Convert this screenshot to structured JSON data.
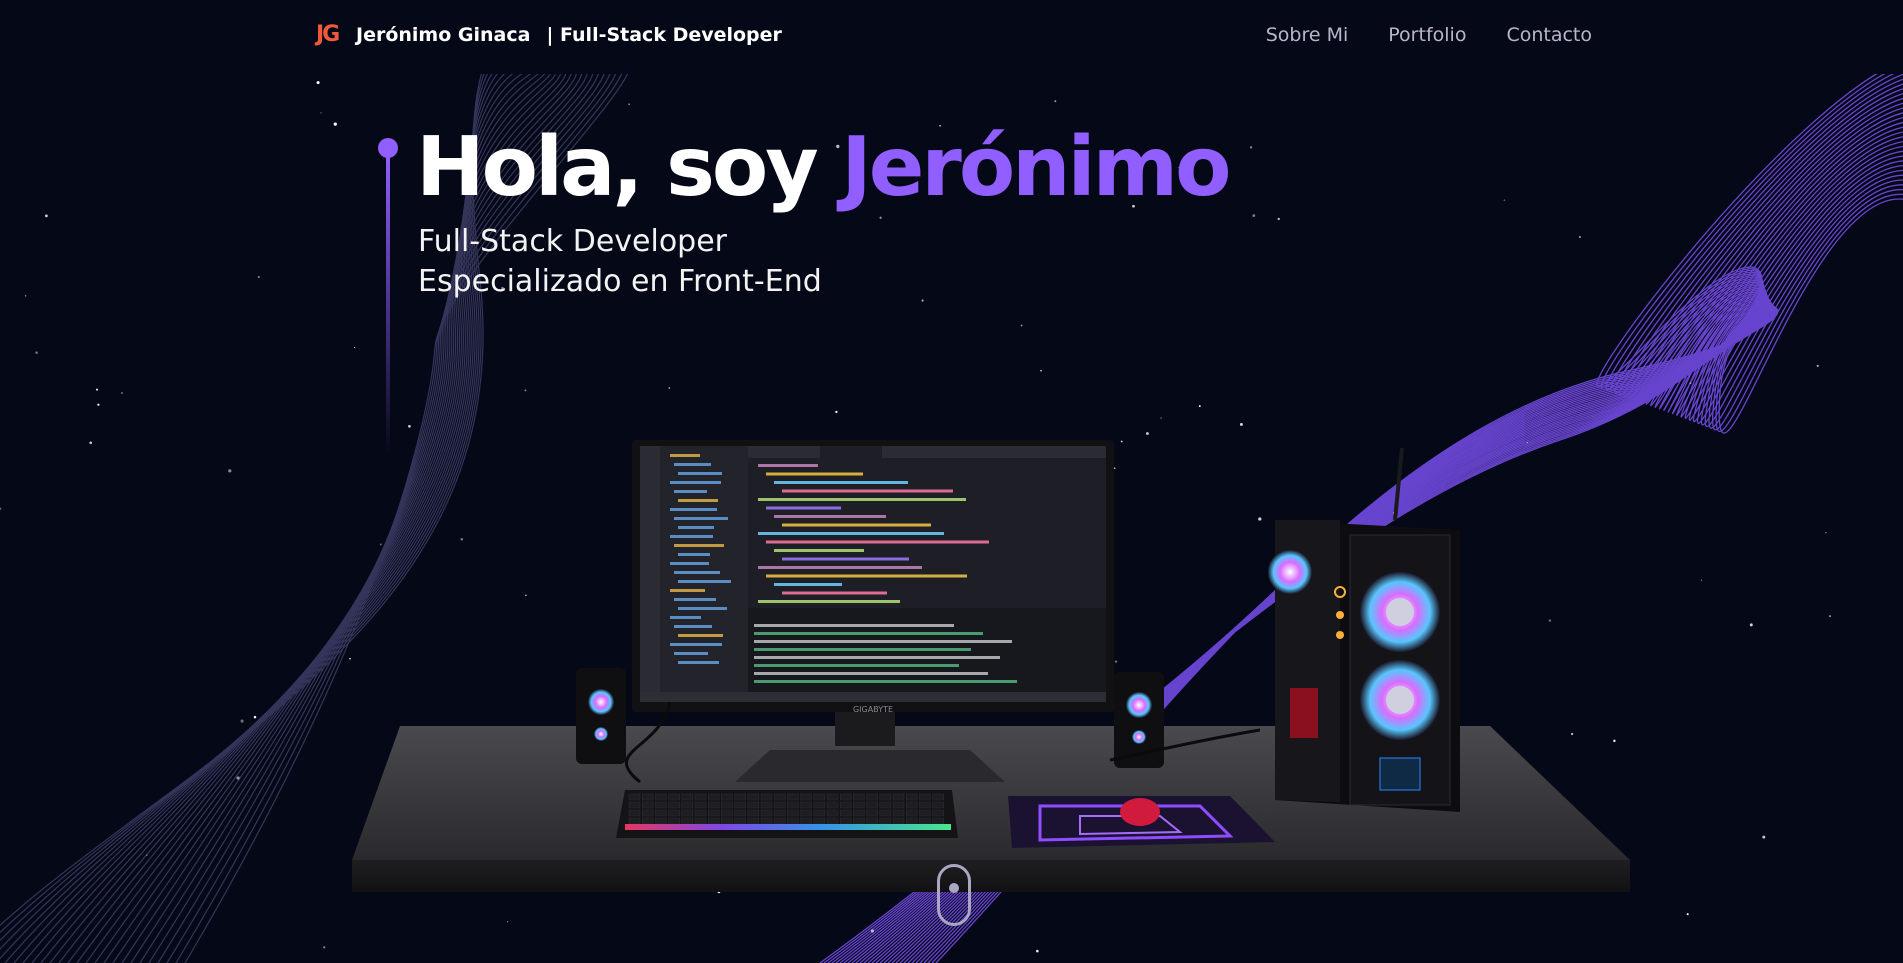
{
  "header": {
    "logo_text": "JG",
    "brand_name": "Jerónimo Ginaca",
    "brand_role": "| Full-Stack Developer",
    "nav": [
      {
        "label": "Sobre Mi",
        "icon": null
      },
      {
        "label": "Portfolio",
        "icon": null
      },
      {
        "label": "Contacto",
        "icon": null
      }
    ]
  },
  "hero": {
    "greeting": "Hola, soy ",
    "name": "Jerónimo",
    "subtitle_line1": "Full-Stack Developer",
    "subtitle_line2": "Especializado en Front-End"
  },
  "monitor_brand": "GIGABYTE",
  "colors": {
    "background": "#050816",
    "accent": "#915eff",
    "logo": "#ef5a3b",
    "nav_text": "#b9b6cc"
  },
  "icons": [
    "logo-icon",
    "scroll-mouse-icon"
  ]
}
